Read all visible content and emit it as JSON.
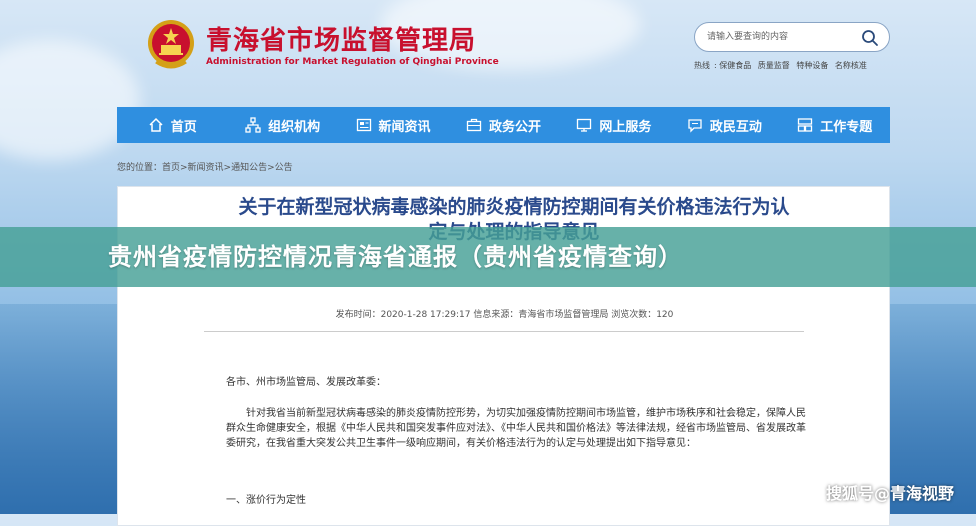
{
  "header": {
    "title": "青海省市场监督管理局",
    "subtitle": "Administration for Market Regulation of Qinghai Province"
  },
  "search": {
    "placeholder": "请输入要查询的内容"
  },
  "utility_links": [
    "热线",
    "保健食品",
    "质量监督",
    "特种设备",
    "名称核准"
  ],
  "nav": {
    "items": [
      {
        "label": "首页",
        "icon": "home-icon"
      },
      {
        "label": "组织机构",
        "icon": "org-chart-icon"
      },
      {
        "label": "新闻资讯",
        "icon": "news-icon"
      },
      {
        "label": "政务公开",
        "icon": "briefcase-icon"
      },
      {
        "label": "网上服务",
        "icon": "monitor-icon"
      },
      {
        "label": "政民互动",
        "icon": "chat-icon"
      },
      {
        "label": "工作专题",
        "icon": "topics-icon"
      }
    ]
  },
  "breadcrumb": "您的位置：首页>新闻资讯>通知公告>公告",
  "article": {
    "title": "关于在新型冠状病毒感染的肺炎疫情防控期间有关价格违法行为认定与处理的指导意见",
    "meta": "发布时间：2020-1-28 17:29:17 信息来源：青海省市场监督管理局 浏览次数：120",
    "salutation": "各市、州市场监管局、发展改革委：",
    "paragraph": "针对我省当前新型冠状病毒感染的肺炎疫情防控形势，为切实加强疫情防控期间市场监管，维护市场秩序和社会稳定，保障人民群众生命健康安全，根据《中华人民共和国突发事件应对法》、《中华人民共和国价格法》等法律法规，经省市场监管局、省发展改革委研究，在我省重大突发公共卫生事件一级响应期间，有关价格违法行为的认定与处理提出如下指导意见：",
    "section_heading": "一、涨价行为定性"
  },
  "overlay": {
    "title": "贵州省疫情防控情况青海省通报（贵州省疫情查询）"
  },
  "watermark": "搜狐号@青海视野",
  "colors": {
    "brand_red": "#c8102e",
    "nav_blue": "#2f8fe0",
    "banner_teal": "#46a096"
  }
}
